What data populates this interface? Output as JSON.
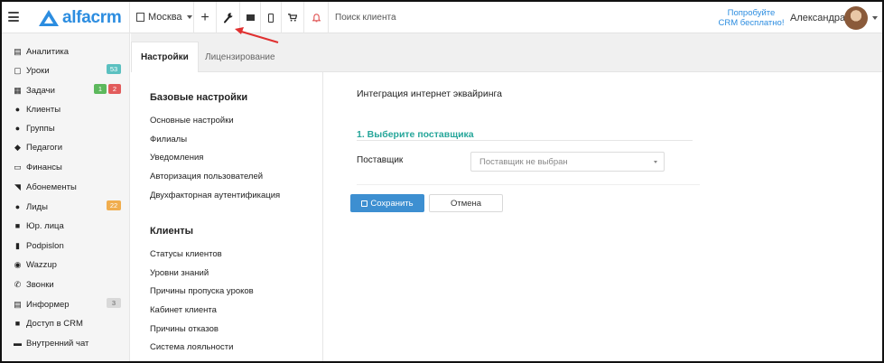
{
  "brand": {
    "name": "alfacrm",
    "color": "#2c8de0"
  },
  "topbar": {
    "city": "Москва",
    "search_placeholder": "Поиск клиента",
    "promo_line1": "Попробуйте",
    "promo_line2": "CRM бесплатно!",
    "user_name": "Александра",
    "icons": [
      "menu-icon",
      "building-icon",
      "plus-icon",
      "wrench-icon",
      "mail-icon",
      "mobile-icon",
      "cart-icon",
      "bell-icon"
    ]
  },
  "sidebar": {
    "items": [
      {
        "label": "Аналитика",
        "icon": "analytics-icon"
      },
      {
        "label": "Уроки",
        "icon": "calendar-icon",
        "badge": "53",
        "badge_color": "#5bc0c0"
      },
      {
        "label": "Задачи",
        "icon": "tasks-icon",
        "badge": "1",
        "badge2": "2"
      },
      {
        "label": "Клиенты",
        "icon": "user-icon"
      },
      {
        "label": "Группы",
        "icon": "users-icon"
      },
      {
        "label": "Педагоги",
        "icon": "teacher-icon"
      },
      {
        "label": "Финансы",
        "icon": "money-icon"
      },
      {
        "label": "Абонементы",
        "icon": "tag-icon"
      },
      {
        "label": "Лиды",
        "icon": "lead-icon",
        "badge": "22",
        "badge_color": "#f0ad4e"
      },
      {
        "label": "Юр. лица",
        "icon": "briefcase-icon"
      },
      {
        "label": "Podpislon",
        "icon": "document-icon"
      },
      {
        "label": "Wazzup",
        "icon": "whatsapp-icon"
      },
      {
        "label": "Звонки",
        "icon": "phone-icon"
      },
      {
        "label": "Информер",
        "icon": "informer-icon",
        "badge": "3",
        "badge_color": "#d9d9d9"
      },
      {
        "label": "Доступ в CRM",
        "icon": "lock-icon"
      },
      {
        "label": "Внутренний чат",
        "icon": "chat-icon"
      }
    ]
  },
  "tabs": [
    {
      "label": "Настройки",
      "active": true
    },
    {
      "label": "Лицензирование",
      "active": false
    }
  ],
  "settings_menu": {
    "section1_title": "Базовые настройки",
    "section1_links": [
      "Основные настройки",
      "Филиалы",
      "Уведомления",
      "Авторизация пользователей",
      "Двухфакторная аутентификация"
    ],
    "section2_title": "Клиенты",
    "section2_links": [
      "Статусы клиентов",
      "Уровни знаний",
      "Причины пропуска уроков",
      "Кабинет клиента",
      "Причины отказов",
      "Система лояльности"
    ]
  },
  "main": {
    "title": "Интеграция интернет эквайринга",
    "step_title": "1. Выберите поставщика",
    "provider_label": "Поставщик",
    "provider_value": "Поставщик не выбран",
    "save_label": "Сохранить",
    "cancel_label": "Отмена"
  },
  "colors": {
    "accent_blue": "#3d8fd1",
    "step_green": "#26a69a",
    "annotation_arrow": "#e03030"
  }
}
